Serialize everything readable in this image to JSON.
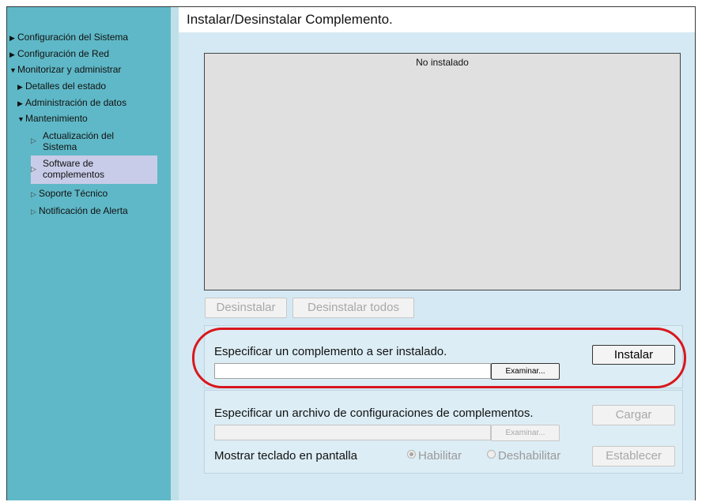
{
  "page": {
    "title": "Instalar/Desinstalar Complemento."
  },
  "sidebar": {
    "items": [
      {
        "label": "Configuración del Sistema",
        "marker": "▶"
      },
      {
        "label": "Configuración de Red",
        "marker": "▶"
      },
      {
        "label": "Monitorizar y administrar",
        "marker": "▼"
      },
      {
        "label": "Detalles del estado",
        "marker": "▶"
      },
      {
        "label": "Administración de datos",
        "marker": "▶"
      },
      {
        "label": "Mantenimiento",
        "marker": "▼"
      },
      {
        "label_line1": "Actualización del",
        "label_line2": "Sistema",
        "marker": "▷"
      },
      {
        "label_line1": "Software de",
        "label_line2": "complementos",
        "marker": "▷",
        "selected": true
      },
      {
        "label": "Soporte Técnico",
        "marker": "▷"
      },
      {
        "label": "Notificación de Alerta",
        "marker": "▷"
      }
    ]
  },
  "plugin_list": {
    "empty_text": "No instalado"
  },
  "buttons": {
    "uninstall": "Desinstalar",
    "uninstall_all": "Desinstalar todos",
    "install": "Instalar",
    "browse": "Examinar...",
    "load": "Cargar",
    "set": "Establecer"
  },
  "install_section": {
    "label": "Especificar un complemento a ser instalado.",
    "file_value": ""
  },
  "settings_section": {
    "label": "Especificar un archivo de configuraciones de complementos.",
    "file_value": "",
    "keyboard_label": "Mostrar teclado en pantalla",
    "enable_label": "Habilitar",
    "disable_label": "Deshabilitar",
    "selected_option": "Habilitar"
  },
  "colors": {
    "sidebar": "#5fb8c7",
    "content": "#d4e9f3",
    "selected_item": "#c9cce8",
    "highlight": "#d9171d"
  }
}
